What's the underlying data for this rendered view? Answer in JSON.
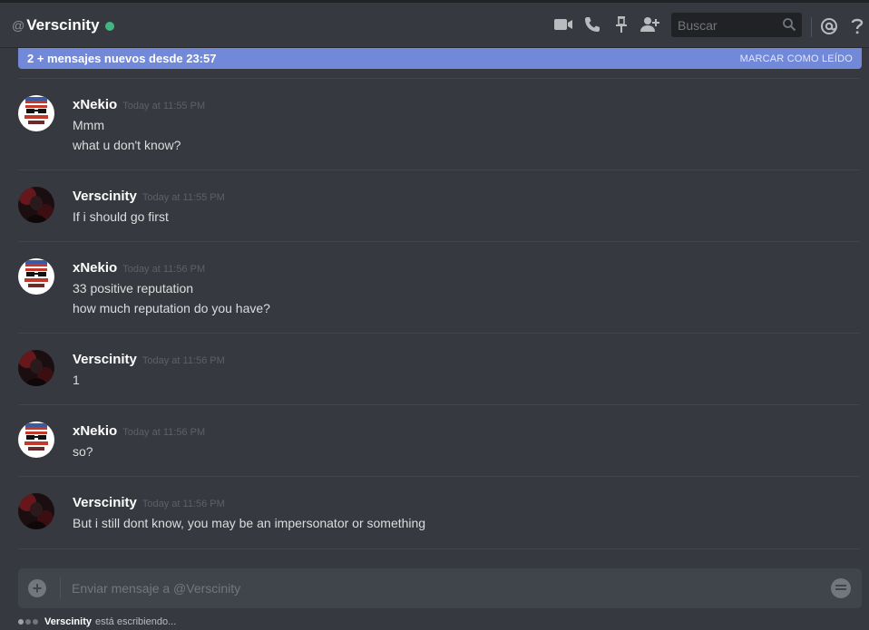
{
  "header": {
    "at_symbol": "@",
    "title": "Verscinity",
    "status": "online",
    "status_color": "#43b581",
    "icons": [
      "video-call-icon",
      "phone-call-icon",
      "pin-icon",
      "add-friend-icon",
      "mention-icon",
      "help-icon"
    ],
    "search_placeholder": "Buscar"
  },
  "new_messages_bar": {
    "text": "2 + mensajes nuevos desde 23:57",
    "action": "MARCAR COMO LEÍDO",
    "color": "#7289da"
  },
  "messages": [
    {
      "author": "xNekio",
      "timestamp": "Today at 11:55 PM",
      "lines": [
        "Mmm",
        "what u don't know?"
      ]
    },
    {
      "author": "Verscinity",
      "timestamp": "Today at 11:55 PM",
      "lines": [
        "If i should go first"
      ]
    },
    {
      "author": "xNekio",
      "timestamp": "Today at 11:56 PM",
      "lines": [
        "33 positive reputation",
        "how much reputation do you have?"
      ]
    },
    {
      "author": "Verscinity",
      "timestamp": "Today at 11:56 PM",
      "lines": [
        "1"
      ]
    },
    {
      "author": "xNekio",
      "timestamp": "Today at 11:56 PM",
      "lines": [
        "so?"
      ]
    },
    {
      "author": "Verscinity",
      "timestamp": "Today at 11:56 PM",
      "lines": [
        "But i still dont know, you may be an impersonator or something"
      ]
    }
  ],
  "composer": {
    "placeholder": "Enviar mensaje a @Verscinity",
    "upload_icon": "plus-icon",
    "emoji_icon": "emoji-icon"
  },
  "typing": {
    "user": "Verscinity",
    "text": "está escribiendo..."
  }
}
